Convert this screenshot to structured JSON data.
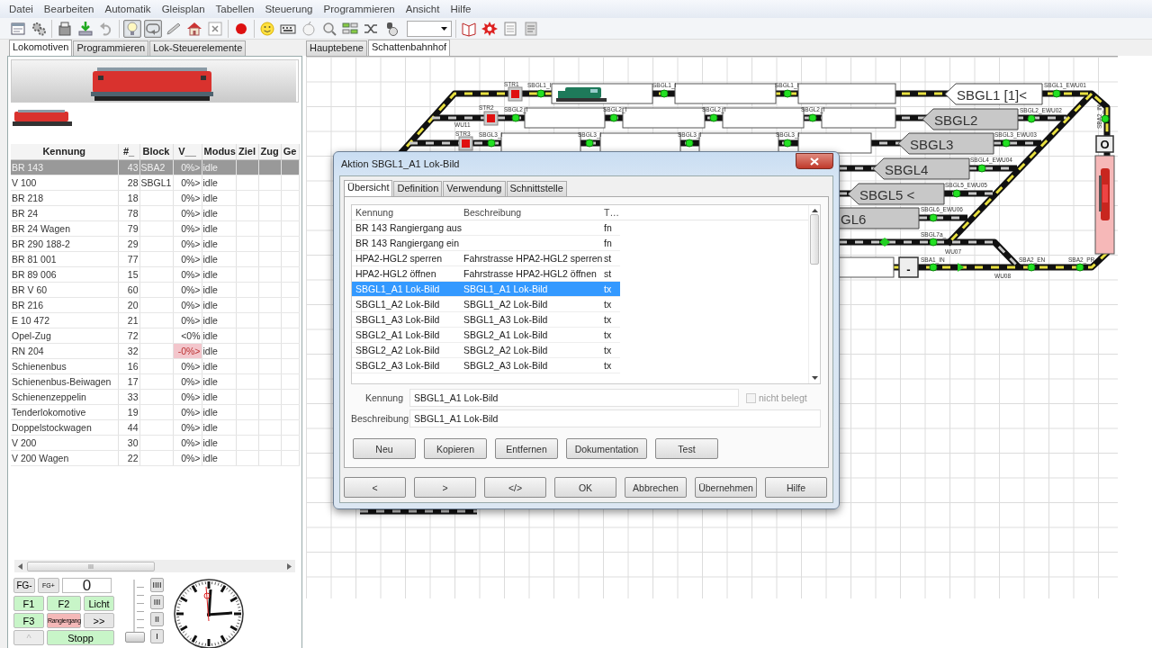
{
  "menu": [
    "Datei",
    "Bearbeiten",
    "Automatik",
    "Gleisplan",
    "Tabellen",
    "Steuerung",
    "Programmieren",
    "Ansicht",
    "Hilfe"
  ],
  "toolbar": [
    [
      {
        "kind": "window",
        "pressed": false
      },
      {
        "kind": "gears",
        "pressed": false
      }
    ],
    [
      {
        "kind": "box",
        "pressed": false
      },
      {
        "kind": "download",
        "pressed": false
      },
      {
        "kind": "undo",
        "pressed": false
      }
    ],
    [
      {
        "kind": "bulb",
        "pressed": true
      },
      {
        "kind": "loop",
        "pressed": true
      },
      {
        "kind": "pen",
        "pressed": false
      },
      {
        "kind": "house",
        "pressed": false
      },
      {
        "kind": "cross",
        "pressed": false
      }
    ],
    [
      {
        "kind": "record",
        "pressed": false
      }
    ],
    [
      {
        "kind": "smiley",
        "pressed": false
      },
      {
        "kind": "keyboard",
        "pressed": false
      },
      {
        "kind": "ball",
        "pressed": false
      },
      {
        "kind": "magnifier",
        "pressed": false
      },
      {
        "kind": "grid",
        "pressed": false
      },
      {
        "kind": "shuffle",
        "pressed": false
      },
      {
        "kind": "jar",
        "pressed": false
      },
      {
        "kind": "combo",
        "pressed": false
      }
    ],
    [
      {
        "kind": "book",
        "pressed": false
      },
      {
        "kind": "burst",
        "pressed": false
      },
      {
        "kind": "note",
        "pressed": false
      },
      {
        "kind": "sheet",
        "pressed": false
      }
    ]
  ],
  "left_tabs": [
    {
      "label": "Lokomotiven",
      "selected": true
    },
    {
      "label": "Programmieren",
      "selected": false
    },
    {
      "label": "Lok-Steuerelemente",
      "selected": false
    }
  ],
  "locos": {
    "columns": [
      "Kennung",
      "#_",
      "Block",
      "V__",
      "Modus",
      "Ziel",
      "Zug",
      "Ge"
    ],
    "rows": [
      {
        "kennung": "BR 143",
        "nr": "43",
        "block": "SBA2",
        "v": "0%>",
        "modus": "idle",
        "selected": true,
        "v_alert": false
      },
      {
        "kennung": "V 100",
        "nr": "28",
        "block": "SBGL1",
        "v": "0%>",
        "modus": "idle",
        "selected": false,
        "v_alert": false
      },
      {
        "kennung": "BR 218",
        "nr": "18",
        "v": "0%>",
        "modus": "idle",
        "selected": false,
        "v_alert": false
      },
      {
        "kennung": "BR 24",
        "nr": "78",
        "v": "0%>",
        "modus": "idle",
        "selected": false,
        "v_alert": false
      },
      {
        "kennung": "BR 24 Wagen",
        "nr": "79",
        "v": "0%>",
        "modus": "idle",
        "selected": false,
        "v_alert": false
      },
      {
        "kennung": "BR 290 188-2",
        "nr": "29",
        "v": "0%>",
        "modus": "idle",
        "selected": false,
        "v_alert": false
      },
      {
        "kennung": "BR 81 001",
        "nr": "77",
        "v": "0%>",
        "modus": "idle",
        "selected": false,
        "v_alert": false
      },
      {
        "kennung": "BR 89 006",
        "nr": "15",
        "v": "0%>",
        "modus": "idle",
        "selected": false,
        "v_alert": false
      },
      {
        "kennung": "BR V 60",
        "nr": "60",
        "v": "0%>",
        "modus": "idle",
        "selected": false,
        "v_alert": false
      },
      {
        "kennung": "BR 216",
        "nr": "20",
        "v": "0%>",
        "modus": "idle",
        "selected": false,
        "v_alert": false
      },
      {
        "kennung": "E 10 472",
        "nr": "21",
        "v": "0%>",
        "modus": "idle",
        "selected": false,
        "v_alert": false
      },
      {
        "kennung": "Opel-Zug",
        "nr": "72",
        "v": "<0%",
        "modus": "idle",
        "selected": false,
        "v_alert": false
      },
      {
        "kennung": "RN 204",
        "nr": "32",
        "v": "-0%>",
        "modus": "idle",
        "selected": false,
        "v_alert": true
      },
      {
        "kennung": "Schienenbus",
        "nr": "16",
        "v": "0%>",
        "modus": "idle",
        "selected": false,
        "v_alert": false
      },
      {
        "kennung": "Schienenbus-Beiwagen",
        "nr": "17",
        "v": "0%>",
        "modus": "idle",
        "selected": false,
        "v_alert": false
      },
      {
        "kennung": "Schienenzeppelin",
        "nr": "33",
        "v": "0%>",
        "modus": "idle",
        "selected": false,
        "v_alert": false
      },
      {
        "kennung": "Tenderlokomotive",
        "nr": "19",
        "v": "0%>",
        "modus": "idle",
        "selected": false,
        "v_alert": false
      },
      {
        "kennung": "Doppelstockwagen",
        "nr": "44",
        "v": "0%>",
        "modus": "idle",
        "selected": false,
        "v_alert": false
      },
      {
        "kennung": "V 200",
        "nr": "30",
        "v": "0%>",
        "modus": "idle",
        "selected": false,
        "v_alert": false
      },
      {
        "kennung": "V 200 Wagen",
        "nr": "22",
        "v": "0%>",
        "modus": "idle",
        "selected": false,
        "v_alert": false
      }
    ]
  },
  "scrollbar_grip": "III",
  "controls": {
    "fg_buttons": [
      "FG-",
      "FG+"
    ],
    "counter": "0",
    "functions": [
      {
        "label": "F1",
        "kind": "active"
      },
      {
        "label": "F2",
        "kind": "active"
      },
      {
        "label": "Licht",
        "kind": "active"
      },
      {
        "label": "F3",
        "kind": "active"
      },
      {
        "label": "Rangiergang",
        "kind": "warning"
      },
      {
        "label": ">>",
        "kind": "plain"
      },
      {
        "label": "^",
        "kind": "disabled"
      },
      {
        "label": "Stopp",
        "kind": "active"
      }
    ],
    "speed": {
      "level": 0
    },
    "steps": [
      "IIII",
      "III",
      "II",
      "I"
    ]
  },
  "right_tabs": [
    {
      "label": "Hauptebene",
      "selected": false
    },
    {
      "label": "Schattenbahnhof",
      "selected": true
    }
  ],
  "track_plan": {
    "blocks": [
      {
        "label": "SBGL1 [1]<",
        "reserved": false
      },
      {
        "label": "SBGL2",
        "reserved": true
      },
      {
        "label": "SBGL3",
        "reserved": true
      },
      {
        "label": "SBGL4",
        "reserved": true
      },
      {
        "label": "SBGL5 <",
        "reserved": true
      },
      {
        "label": "GL6",
        "reserved": true
      }
    ],
    "labels": [
      "STR1",
      "STR2",
      "STR3",
      "WU11",
      "SBGL1_I",
      "SBGL1_I",
      "SBGL1_I",
      "SBGL2_I",
      "SBGL2_I",
      "SBGL2_I",
      "SBGL2_I",
      "SBGL3_I",
      "SBGL3_I",
      "SBGL3_I",
      "SBGL3_I",
      "SBGL1_EWU01",
      "SBGL2_EWU02",
      "SBGL3_EWU03",
      "SBGL4_EWU04",
      "SBGL5_EWU05",
      "SBGL6_EWU06",
      "SBGL7a_",
      "WU07",
      "SBA1_IN",
      "WU08",
      "SBA2_EN",
      "SBA2_PR",
      "SBA2_IN"
    ],
    "switch_buttons": [
      "O",
      "-"
    ],
    "occupied_block": {
      "occupied": true
    }
  },
  "dialog": {
    "title": "Aktion SBGL1_A1 Lok-Bild",
    "tabs": [
      {
        "label": "Übersicht",
        "selected": true
      },
      {
        "label": "Definition",
        "selected": false
      },
      {
        "label": "Verwendung",
        "selected": false
      },
      {
        "label": "Schnittstelle",
        "selected": false
      }
    ],
    "columns": [
      "Kennung",
      "Beschreibung",
      "T…"
    ],
    "rows": [
      {
        "kennung": "BR 143 Rangiergang aus",
        "typ": "fn",
        "selected": false
      },
      {
        "kennung": "BR 143 Rangiergang ein",
        "typ": "fn",
        "selected": false
      },
      {
        "kennung": "HPA2-HGL2 sperren",
        "beschreibung": "Fahrstrasse HPA2-HGL2 sperren",
        "typ": "st",
        "selected": false
      },
      {
        "kennung": "HPA2-HGL2 öffnen",
        "beschreibung": "Fahrstrasse HPA2-HGL2 öffnen",
        "typ": "st",
        "selected": false
      },
      {
        "kennung": "SBGL1_A1 Lok-Bild",
        "beschreibung": "SBGL1_A1 Lok-Bild",
        "typ": "tx",
        "selected": true
      },
      {
        "kennung": "SBGL1_A2 Lok-Bild",
        "beschreibung": "SBGL1_A2 Lok-Bild",
        "typ": "tx",
        "selected": false
      },
      {
        "kennung": "SBGL1_A3 Lok-Bild",
        "beschreibung": "SBGL1_A3 Lok-Bild",
        "typ": "tx",
        "selected": false
      },
      {
        "kennung": "SBGL2_A1 Lok-Bild",
        "beschreibung": "SBGL2_A1 Lok-Bild",
        "typ": "tx",
        "selected": false
      },
      {
        "kennung": "SBGL2_A2 Lok-Bild",
        "beschreibung": "SBGL2_A2 Lok-Bild",
        "typ": "tx",
        "selected": false
      },
      {
        "kennung": "SBGL2_A3 Lok-Bild",
        "beschreibung": "SBGL2_A3 Lok-Bild",
        "typ": "tx",
        "selected": false
      }
    ],
    "fields": [
      {
        "label": "Kennung",
        "value": "SBGL1_A1 Lok-Bild"
      },
      {
        "label": "Beschreibung",
        "value": "SBGL1_A1 Lok-Bild"
      }
    ],
    "checkbox": {
      "label": "nicht belegt",
      "checked": false,
      "disabled": true
    },
    "actions": [
      "Neu",
      "Kopieren",
      "Entfernen",
      "Dokumentation",
      "Test"
    ],
    "buttons": [
      "<",
      ">",
      "</>",
      "OK",
      "Abbrechen",
      "Übernehmen",
      "Hilfe"
    ]
  }
}
